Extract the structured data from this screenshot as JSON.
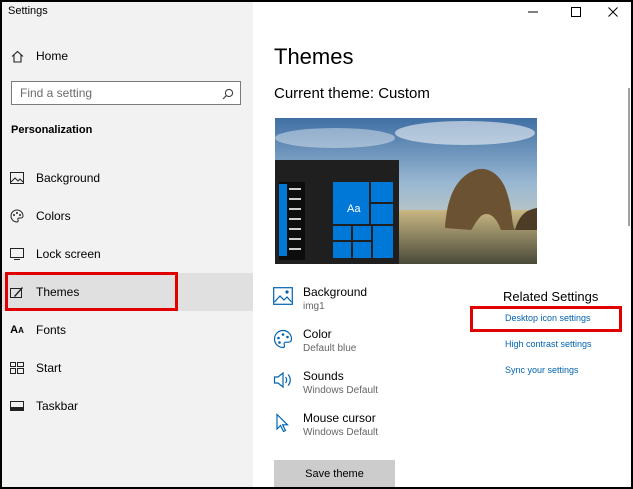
{
  "window": {
    "title": "Settings"
  },
  "sidebar": {
    "home": "Home",
    "search_placeholder": "Find a setting",
    "section": "Personalization",
    "items": [
      {
        "label": "Background",
        "icon": "background-icon"
      },
      {
        "label": "Colors",
        "icon": "colors-icon"
      },
      {
        "label": "Lock screen",
        "icon": "lock-screen-icon"
      },
      {
        "label": "Themes",
        "icon": "themes-icon",
        "selected": true
      },
      {
        "label": "Fonts",
        "icon": "fonts-icon"
      },
      {
        "label": "Start",
        "icon": "start-icon"
      },
      {
        "label": "Taskbar",
        "icon": "taskbar-icon"
      }
    ]
  },
  "main": {
    "title": "Themes",
    "current_theme": "Current theme: Custom",
    "preview_sample": "Aa",
    "properties": [
      {
        "name": "Background",
        "value": "img1",
        "icon": "picture-icon"
      },
      {
        "name": "Color",
        "value": "Default blue",
        "icon": "palette-icon"
      },
      {
        "name": "Sounds",
        "value": "Windows Default",
        "icon": "speaker-icon"
      },
      {
        "name": "Mouse cursor",
        "value": "Windows Default",
        "icon": "cursor-icon"
      }
    ],
    "related": {
      "heading": "Related Settings",
      "links": [
        "Desktop icon settings",
        "High contrast settings",
        "Sync your settings"
      ]
    },
    "save_button": "Save theme"
  },
  "colors": {
    "accent": "#0078d7",
    "link": "#0063b1",
    "highlight": "#e00000"
  }
}
